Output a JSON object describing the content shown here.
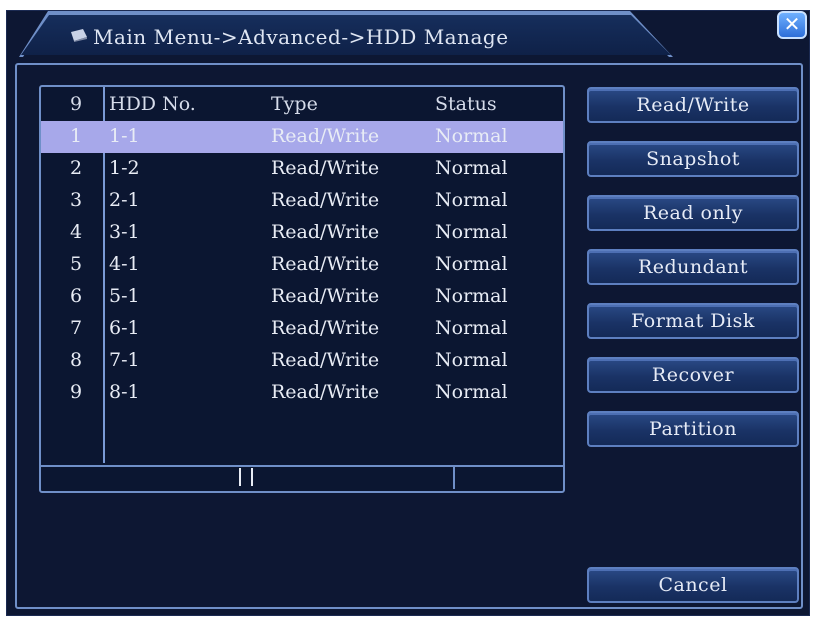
{
  "window": {
    "title": "Main Menu->Advanced->HDD Manage",
    "close_label": "✕"
  },
  "table": {
    "header": {
      "idx": "9",
      "hdd_no": "HDD No.",
      "type": "Type",
      "status": "Status"
    },
    "rows": [
      {
        "idx": "1",
        "hdd_no": "1-1",
        "type": "Read/Write",
        "status": "Normal"
      },
      {
        "idx": "2",
        "hdd_no": "1-2",
        "type": "Read/Write",
        "status": "Normal"
      },
      {
        "idx": "3",
        "hdd_no": "2-1",
        "type": "Read/Write",
        "status": "Normal"
      },
      {
        "idx": "4",
        "hdd_no": "3-1",
        "type": "Read/Write",
        "status": "Normal"
      },
      {
        "idx": "5",
        "hdd_no": "4-1",
        "type": "Read/Write",
        "status": "Normal"
      },
      {
        "idx": "6",
        "hdd_no": "5-1",
        "type": "Read/Write",
        "status": "Normal"
      },
      {
        "idx": "7",
        "hdd_no": "6-1",
        "type": "Read/Write",
        "status": "Normal"
      },
      {
        "idx": "8",
        "hdd_no": "7-1",
        "type": "Read/Write",
        "status": "Normal"
      },
      {
        "idx": "9",
        "hdd_no": "8-1",
        "type": "Read/Write",
        "status": "Normal"
      }
    ],
    "selected_row": 0
  },
  "buttons": {
    "read_write": "Read/Write",
    "snapshot": "Snapshot",
    "read_only": "Read only",
    "redundant": "Redundant",
    "format_disk": "Format Disk",
    "recover": "Recover",
    "partition": "Partition",
    "cancel": "Cancel"
  },
  "colors": {
    "background": "#0d1733",
    "border": "#6f8fc8",
    "selected_row": "#a7a8ea",
    "close_button": "#2d6ed8"
  },
  "icons": {
    "title": "hdd-icon",
    "close": "close-icon"
  }
}
